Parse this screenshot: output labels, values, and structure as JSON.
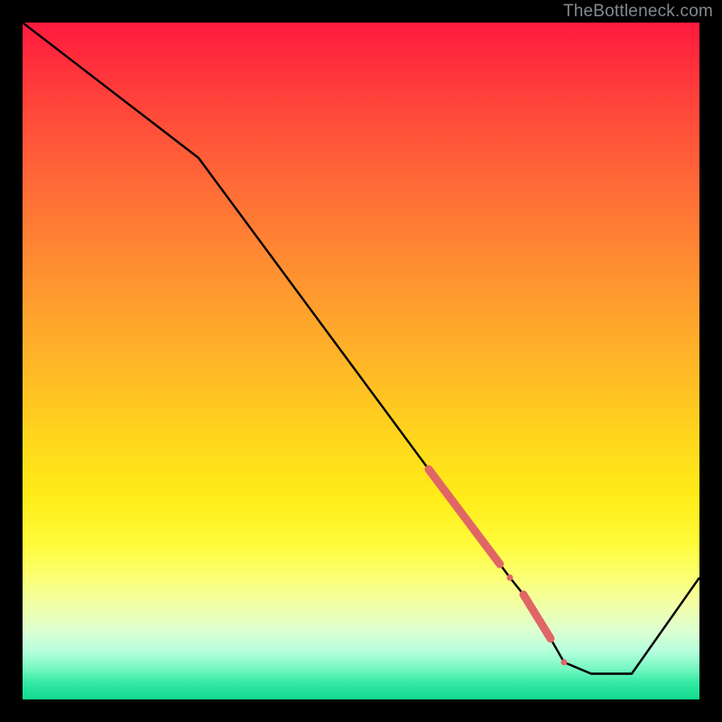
{
  "watermark": "TheBottleneck.com",
  "colors": {
    "background": "#000000",
    "curve": "#000000",
    "marker": "#e06666",
    "gradient_top": "#ff1a3e",
    "gradient_bottom": "#11d98e"
  },
  "chart_data": {
    "type": "line",
    "title": "",
    "xlabel": "",
    "ylabel": "",
    "xlim": [
      0,
      100
    ],
    "ylim": [
      0,
      100
    ],
    "grid": false,
    "legend": false,
    "series": [
      {
        "name": "bottleneck-curve",
        "x": [
          0,
          26,
          60,
          63,
          66,
          69,
          70.5,
          72,
          74,
          76,
          78,
          80,
          84,
          90,
          100
        ],
        "y": [
          100,
          80,
          34,
          30,
          26,
          22,
          20,
          18,
          15.5,
          13,
          9,
          5.5,
          3.8,
          3.8,
          18
        ]
      }
    ],
    "markers": [
      {
        "segment": "thick-upper",
        "x_start": 60,
        "x_end": 70.5,
        "y_start": 34,
        "y_end": 20,
        "radius": 4.5
      },
      {
        "segment": "dot-mid",
        "x_start": 72,
        "x_end": 72,
        "y_start": 18,
        "y_end": 18,
        "radius": 3.5
      },
      {
        "segment": "thick-lower",
        "x_start": 74,
        "x_end": 78,
        "y_start": 15.5,
        "y_end": 9,
        "radius": 4.5
      },
      {
        "segment": "dot-bottom",
        "x_start": 80,
        "x_end": 80,
        "y_start": 5.5,
        "y_end": 5.5,
        "radius": 3.5
      }
    ],
    "annotations": []
  }
}
